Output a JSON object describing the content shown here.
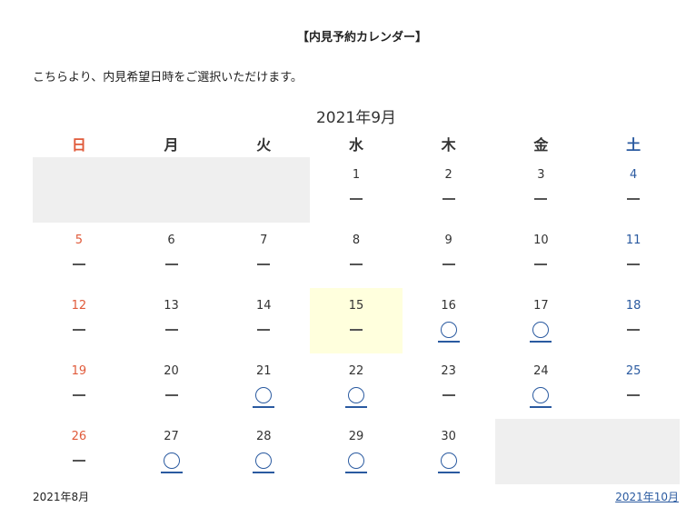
{
  "header": {
    "title": "【内見予約カレンダー】",
    "intro": "こちらより、内見希望日時をご選択いただけます。"
  },
  "calendar": {
    "month_label": "2021年9月",
    "weekdays": [
      "日",
      "月",
      "火",
      "水",
      "木",
      "金",
      "土"
    ],
    "weeks": [
      [
        null,
        null,
        null,
        {
          "day": "1",
          "status": "unavailable"
        },
        {
          "day": "2",
          "status": "unavailable"
        },
        {
          "day": "3",
          "status": "unavailable"
        },
        {
          "day": "4",
          "status": "unavailable"
        }
      ],
      [
        {
          "day": "5",
          "status": "unavailable"
        },
        {
          "day": "6",
          "status": "unavailable"
        },
        {
          "day": "7",
          "status": "unavailable"
        },
        {
          "day": "8",
          "status": "unavailable"
        },
        {
          "day": "9",
          "status": "unavailable"
        },
        {
          "day": "10",
          "status": "unavailable"
        },
        {
          "day": "11",
          "status": "unavailable"
        }
      ],
      [
        {
          "day": "12",
          "status": "unavailable"
        },
        {
          "day": "13",
          "status": "unavailable"
        },
        {
          "day": "14",
          "status": "unavailable"
        },
        {
          "day": "15",
          "status": "unavailable",
          "today": true
        },
        {
          "day": "16",
          "status": "available"
        },
        {
          "day": "17",
          "status": "available"
        },
        {
          "day": "18",
          "status": "unavailable"
        }
      ],
      [
        {
          "day": "19",
          "status": "unavailable"
        },
        {
          "day": "20",
          "status": "unavailable"
        },
        {
          "day": "21",
          "status": "available"
        },
        {
          "day": "22",
          "status": "available"
        },
        {
          "day": "23",
          "status": "unavailable"
        },
        {
          "day": "24",
          "status": "available"
        },
        {
          "day": "25",
          "status": "unavailable"
        }
      ],
      [
        {
          "day": "26",
          "status": "unavailable"
        },
        {
          "day": "27",
          "status": "available"
        },
        {
          "day": "28",
          "status": "available"
        },
        {
          "day": "29",
          "status": "available"
        },
        {
          "day": "30",
          "status": "available"
        },
        null,
        null
      ]
    ]
  },
  "nav": {
    "prev_label": "2021年8月",
    "next_label": "2021年10月"
  },
  "colors": {
    "sunday": "#e05a3a",
    "saturday": "#2a5aa0",
    "link": "#2a5aa0",
    "empty_cell": "#efefef",
    "today_cell": "#ffffdd"
  },
  "icons": {
    "available": "circle-icon",
    "unavailable": "dash-icon"
  }
}
